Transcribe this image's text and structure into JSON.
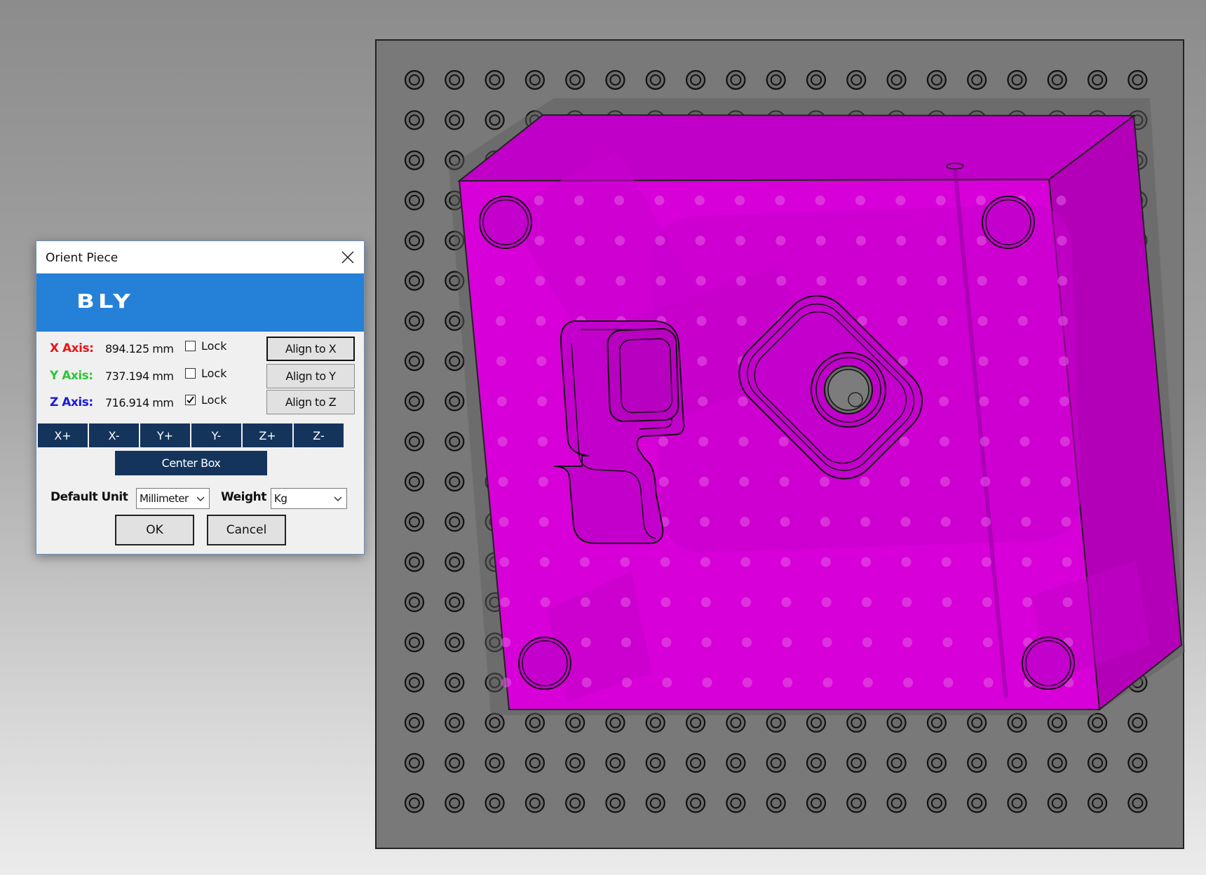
{
  "dialog": {
    "title": "Orient Piece",
    "brand": "BLY",
    "axes": [
      {
        "label": "X Axis:",
        "value": "894.125 mm",
        "color": "#e8161a",
        "lock_label": "Lock",
        "locked": false,
        "align_label": "Align to X"
      },
      {
        "label": "Y Axis:",
        "value": "737.194 mm",
        "color": "#2fc43a",
        "lock_label": "Lock",
        "locked": false,
        "align_label": "Align to Y"
      },
      {
        "label": "Z Axis:",
        "value": "716.914 mm",
        "color": "#1a1ae0",
        "lock_label": "Lock",
        "locked": true,
        "align_label": "Align to Z"
      }
    ],
    "direction_buttons": [
      "X+",
      "X-",
      "Y+",
      "Y-",
      "Z+",
      "Z-"
    ],
    "center_box_label": "Center Box",
    "default_unit_label": "Default Unit",
    "unit_value": "Millimeter",
    "weight_label": "Weight",
    "weight_value": "Kg",
    "ok_label": "OK",
    "cancel_label": "Cancel"
  },
  "scene": {
    "part_color": "#d800d8",
    "plate_color": "#7a7a7a"
  },
  "icons": [
    "close-icon",
    "chevron-down-icon",
    "checkmark-icon"
  ]
}
